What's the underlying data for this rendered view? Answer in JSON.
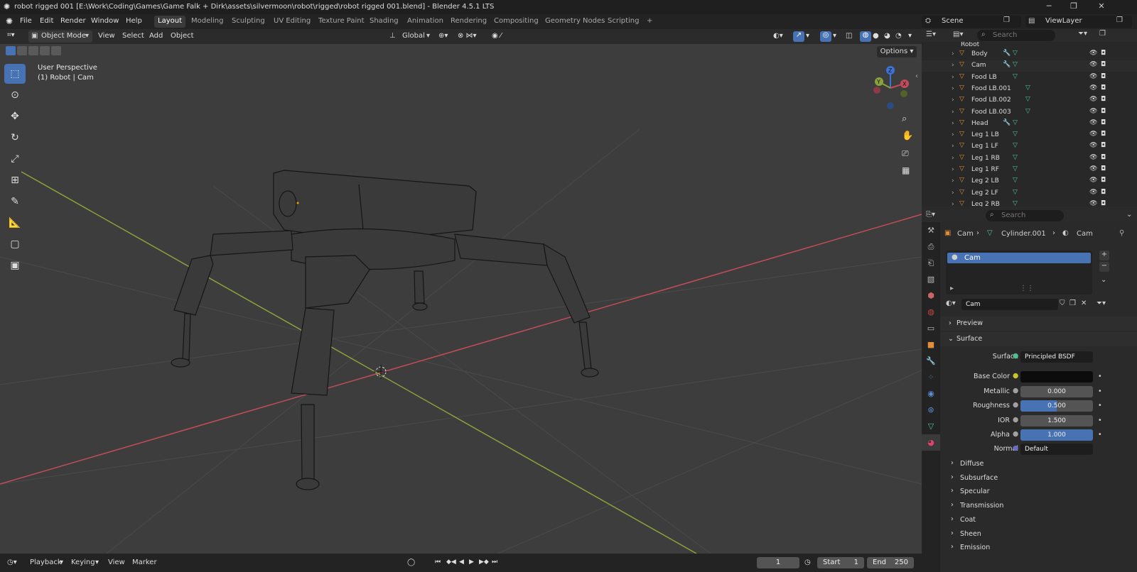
{
  "window": {
    "title": "robot rigged 001 [E:\\Work\\Coding\\Games\\Game Falk + Dirk\\assets\\silvermoon\\robot\\rigged\\robot rigged 001.blend] - Blender 4.5.1 LTS",
    "controls": {
      "minimize": "─",
      "maximize": "❐",
      "close": "✕"
    }
  },
  "menu": {
    "items": [
      "File",
      "Edit",
      "Render",
      "Window",
      "Help"
    ],
    "tabs": [
      "Layout",
      "Modeling",
      "Sculpting",
      "UV Editing",
      "Texture Paint",
      "Shading",
      "Animation",
      "Rendering",
      "Compositing",
      "Geometry Nodes",
      "Scripting"
    ],
    "add_tab": "+",
    "active_tab": "Layout",
    "scene": "Scene",
    "view_layer": "ViewLayer"
  },
  "viewport_header": {
    "mode": "Object Mode",
    "items": [
      "View",
      "Select",
      "Add",
      "Object"
    ],
    "transform": "Global",
    "options": "Options"
  },
  "viewport": {
    "perspective": "User Perspective",
    "context": "(1) Robot | Cam",
    "gizmo": {
      "z": "Z",
      "y": "Y",
      "x": "X"
    }
  },
  "outliner": {
    "search_placeholder": "Search",
    "root": "Robot",
    "items": [
      "Body",
      "Cam",
      "Food LB",
      "Food LB.001",
      "Food LB.002",
      "Food LB.003",
      "Head",
      "Leg 1 LB",
      "Leg 1 LF",
      "Leg 1 RB",
      "Leg 1 RF",
      "Leg 2 LB",
      "Leg 2 LF",
      "Leg 2 RB"
    ]
  },
  "properties": {
    "search_placeholder": "Search",
    "breadcrumb": [
      "Cam",
      "Cylinder.001",
      "Cam"
    ],
    "material_slot": "Cam",
    "material_name": "Cam",
    "sections": {
      "preview": "Preview",
      "surface": "Surface"
    },
    "surface": {
      "label": "Surface",
      "value": "Principled BSDF"
    },
    "fields": [
      {
        "label": "Base Color",
        "value": "",
        "fill": 0
      },
      {
        "label": "Metallic",
        "value": "0.000",
        "fill": 0
      },
      {
        "label": "Roughness",
        "value": "0.500",
        "fill": 0.5
      },
      {
        "label": "IOR",
        "value": "1.500",
        "fill": 0
      },
      {
        "label": "Alpha",
        "value": "1.000",
        "fill": 1
      }
    ],
    "normal": {
      "label": "Normal",
      "value": "Default"
    },
    "subsections": [
      "Diffuse",
      "Subsurface",
      "Specular",
      "Transmission",
      "Coat",
      "Sheen",
      "Emission"
    ]
  },
  "timeline": {
    "items": [
      "Playback",
      "Keying",
      "View",
      "Marker"
    ],
    "current_frame": "1",
    "start_label": "Start",
    "start": "1",
    "end_label": "End",
    "end": "250"
  },
  "colors": {
    "accent": "#4772b3",
    "x_axis": "#c24c5a",
    "y_axis": "#8aa23a",
    "object_orange": "#e08d3c",
    "mesh_green": "#4fc08d"
  }
}
